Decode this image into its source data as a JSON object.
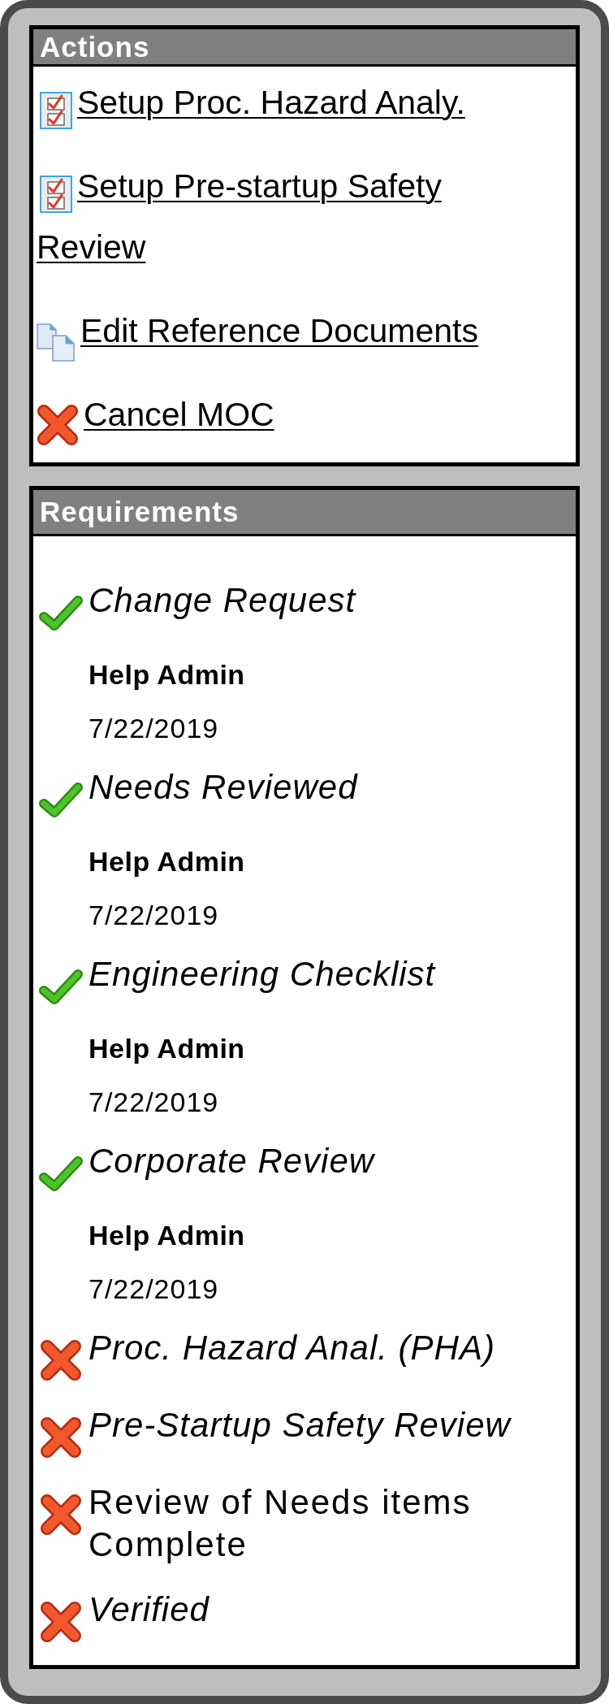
{
  "actions": {
    "title": "Actions",
    "items": [
      {
        "label": "Setup Proc. Hazard Analy.",
        "kind": "checklist"
      },
      {
        "label": "Setup Pre-startup Safety Review",
        "kind": "checklist"
      },
      {
        "label": "Edit Reference Documents",
        "kind": "documents"
      },
      {
        "label": "Cancel MOC",
        "kind": "cancel"
      }
    ]
  },
  "requirements": {
    "title": "Requirements",
    "items": [
      {
        "name": "Change Request",
        "complete": true,
        "emphasized": true,
        "completed_by": "Help Admin",
        "date": "7/22/2019"
      },
      {
        "name": "Needs Reviewed",
        "complete": true,
        "emphasized": true,
        "completed_by": "Help Admin",
        "date": "7/22/2019"
      },
      {
        "name": "Engineering Checklist",
        "complete": true,
        "emphasized": true,
        "completed_by": "Help Admin",
        "date": "7/22/2019"
      },
      {
        "name": "Corporate Review",
        "complete": true,
        "emphasized": true,
        "completed_by": "Help Admin",
        "date": "7/22/2019"
      },
      {
        "name": "Proc. Hazard Anal. (PHA)",
        "complete": false,
        "emphasized": true
      },
      {
        "name": "Pre-Startup Safety Review",
        "complete": false,
        "emphasized": true
      },
      {
        "name": "Review of Needs items Complete",
        "complete": false,
        "emphasized": false
      },
      {
        "name": "Verified",
        "complete": false,
        "emphasized": true
      }
    ]
  }
}
